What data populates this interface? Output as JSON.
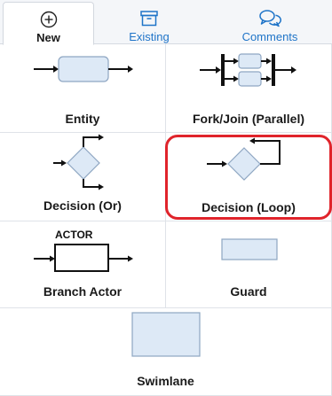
{
  "tabs": {
    "new_label": "New",
    "existing_label": "Existing",
    "comments_label": "Comments"
  },
  "shapes": {
    "entity": "Entity",
    "fork_join": "Fork/Join (Parallel)",
    "decision_or": "Decision (Or)",
    "decision_loop": "Decision (Loop)",
    "branch_actor": "Branch Actor",
    "branch_actor_tag": "ACTOR",
    "guard": "Guard",
    "swimlane": "Swimlane"
  },
  "selected_shape": "decision_loop",
  "colors": {
    "accent": "#1f74c8",
    "highlight": "#e0242b",
    "shape_fill": "#dde9f6",
    "shape_stroke": "#8ea6c2"
  },
  "icons": {
    "new": "plus-circle-icon",
    "existing": "archive-box-icon",
    "comments": "chat-bubbles-icon"
  }
}
